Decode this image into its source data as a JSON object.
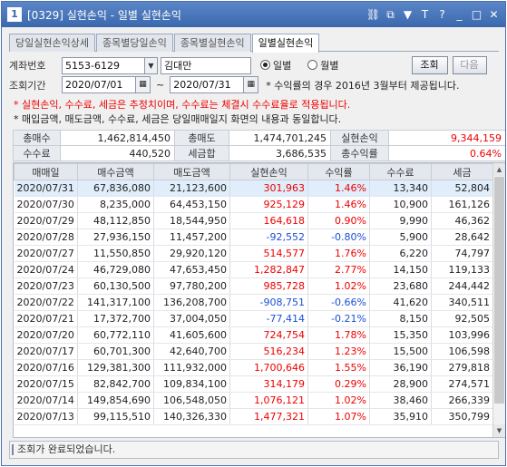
{
  "window": {
    "number": "1",
    "title": "[0329] 실현손익 - 일별 실현손익"
  },
  "title_icons": [
    "link-icon",
    "copy-icon",
    "pin-icon",
    "text-size-icon",
    "help-icon",
    "minimize-icon",
    "maximize-icon",
    "close-icon"
  ],
  "title_glyphs": {
    "link": "⛓",
    "copy": "⧉",
    "pin": "▼",
    "textsize": "T",
    "help": "?",
    "minimize": "_",
    "maximize": "□",
    "close": "✕"
  },
  "tabs": [
    "당일실현손익상세",
    "종목별당일손익",
    "종목별실현손익",
    "일별실현손익"
  ],
  "form": {
    "account_label": "계좌번호",
    "account_value": "5153-6129",
    "owner_name": "김대만",
    "radio_daily": "일별",
    "radio_monthly": "월별",
    "period_label": "조회기간",
    "date_from": "2020/07/01",
    "date_to": "2020/07/31",
    "tilde": "~",
    "info_text": "* 수익률의 경우 2016년 3월부터 제공됩니다.",
    "search_button": "조회",
    "next_button": "다음"
  },
  "notes": {
    "warning": "* 실현손익, 수수료, 세금은 추정치이며, 수수료는 체결시 수수료율로 적용됩니다.",
    "info": "* 매입금액, 매도금액, 수수료, 세금은 당일매매일지 화면의 내용과 동일합니다."
  },
  "summary": {
    "total_buy_label": "총매수",
    "total_buy": "1,462,814,450",
    "total_sell_label": "총매도",
    "total_sell": "1,474,701,245",
    "realized_label": "실현손익",
    "realized": "9,344,159",
    "fee_label": "수수료",
    "fee": "440,520",
    "tax_label": "세금합",
    "tax": "3,686,535",
    "total_return_label": "총수익률",
    "total_return": "0.64%"
  },
  "grid": {
    "columns": [
      "매매일",
      "매수금액",
      "매도금액",
      "실현손익",
      "수익률",
      "수수료",
      "세금"
    ],
    "rows": [
      {
        "date": "2020/07/31",
        "buy": "67,836,080",
        "sell": "21,123,600",
        "pnl": "301,963",
        "rate": "1.46%",
        "fee": "13,340",
        "tax": "52,804",
        "sign": "pos"
      },
      {
        "date": "2020/07/30",
        "buy": "8,235,000",
        "sell": "64,453,150",
        "pnl": "925,129",
        "rate": "1.46%",
        "fee": "10,900",
        "tax": "161,126",
        "sign": "pos"
      },
      {
        "date": "2020/07/29",
        "buy": "48,112,850",
        "sell": "18,544,950",
        "pnl": "164,618",
        "rate": "0.90%",
        "fee": "9,990",
        "tax": "46,362",
        "sign": "pos"
      },
      {
        "date": "2020/07/28",
        "buy": "27,936,150",
        "sell": "11,457,200",
        "pnl": "-92,552",
        "rate": "-0.80%",
        "fee": "5,900",
        "tax": "28,642",
        "sign": "neg"
      },
      {
        "date": "2020/07/27",
        "buy": "11,550,850",
        "sell": "29,920,120",
        "pnl": "514,577",
        "rate": "1.76%",
        "fee": "6,220",
        "tax": "74,797",
        "sign": "pos"
      },
      {
        "date": "2020/07/24",
        "buy": "46,729,080",
        "sell": "47,653,450",
        "pnl": "1,282,847",
        "rate": "2.77%",
        "fee": "14,150",
        "tax": "119,133",
        "sign": "pos"
      },
      {
        "date": "2020/07/23",
        "buy": "60,130,500",
        "sell": "97,780,200",
        "pnl": "985,728",
        "rate": "1.02%",
        "fee": "23,680",
        "tax": "244,442",
        "sign": "pos"
      },
      {
        "date": "2020/07/22",
        "buy": "141,317,100",
        "sell": "136,208,700",
        "pnl": "-908,751",
        "rate": "-0.66%",
        "fee": "41,620",
        "tax": "340,511",
        "sign": "neg"
      },
      {
        "date": "2020/07/21",
        "buy": "17,372,700",
        "sell": "37,004,050",
        "pnl": "-77,414",
        "rate": "-0.21%",
        "fee": "8,150",
        "tax": "92,505",
        "sign": "neg"
      },
      {
        "date": "2020/07/20",
        "buy": "60,772,110",
        "sell": "41,605,600",
        "pnl": "724,754",
        "rate": "1.78%",
        "fee": "15,350",
        "tax": "103,996",
        "sign": "pos"
      },
      {
        "date": "2020/07/17",
        "buy": "60,701,300",
        "sell": "42,640,700",
        "pnl": "516,234",
        "rate": "1.23%",
        "fee": "15,500",
        "tax": "106,598",
        "sign": "pos"
      },
      {
        "date": "2020/07/16",
        "buy": "129,381,300",
        "sell": "111,932,000",
        "pnl": "1,700,646",
        "rate": "1.55%",
        "fee": "36,190",
        "tax": "279,818",
        "sign": "pos"
      },
      {
        "date": "2020/07/15",
        "buy": "82,842,700",
        "sell": "109,834,100",
        "pnl": "314,179",
        "rate": "0.29%",
        "fee": "28,900",
        "tax": "274,571",
        "sign": "pos"
      },
      {
        "date": "2020/07/14",
        "buy": "149,854,690",
        "sell": "106,548,050",
        "pnl": "1,076,121",
        "rate": "1.02%",
        "fee": "38,460",
        "tax": "266,339",
        "sign": "pos"
      },
      {
        "date": "2020/07/13",
        "buy": "99,115,510",
        "sell": "140,326,330",
        "pnl": "1,477,321",
        "rate": "1.07%",
        "fee": "35,910",
        "tax": "350,799",
        "sign": "pos"
      }
    ]
  },
  "status_text": "조회가 완료되었습니다.",
  "colors": {
    "positive": "#e00000",
    "negative": "#1c4fd6",
    "selected_row": "#dfeefa",
    "title_bar": "#4a77bd"
  }
}
